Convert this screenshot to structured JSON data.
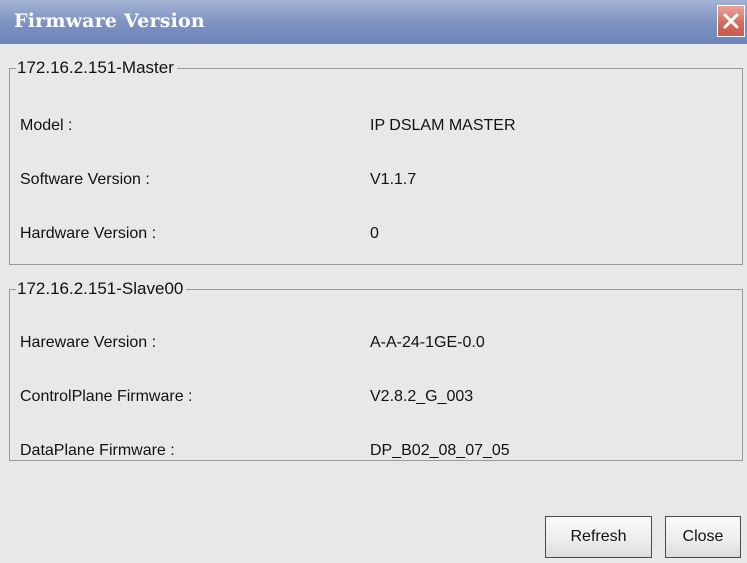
{
  "window": {
    "title": "Firmware Version",
    "close_icon": "close-icon"
  },
  "master": {
    "legend": "172.16.2.151-Master",
    "rows": [
      {
        "label": "Model :",
        "value": "IP DSLAM MASTER"
      },
      {
        "label": "Software Version :",
        "value": "V1.1.7"
      },
      {
        "label": "Hardware Version :",
        "value": "0"
      }
    ]
  },
  "slave": {
    "legend": "172.16.2.151-Slave00",
    "rows": [
      {
        "label": "Hareware Version :",
        "value": "A-A-24-1GE-0.0"
      },
      {
        "label": "ControlPlane Firmware :",
        "value": "V2.8.2_G_003"
      },
      {
        "label": "DataPlane Firmware :",
        "value": "DP_B02_08_07_05"
      }
    ]
  },
  "buttons": {
    "refresh": "Refresh",
    "close": "Close"
  },
  "colors": {
    "titlebar": "#7c91c2",
    "close_button": "#d06a5e",
    "dialog_bg": "#e8e8e8"
  }
}
